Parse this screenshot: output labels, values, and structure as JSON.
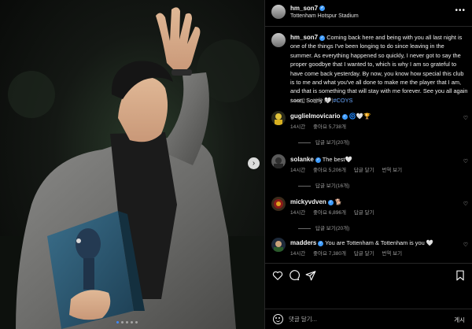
{
  "header": {
    "username": "hm_son7",
    "location": "Tottenham Hotspur Stadium",
    "more_icon": "more-horizontal-icon"
  },
  "caption": {
    "username": "hm_son7",
    "text": "Coming back here and being with you all last night is one of the things I've been longing to do since leaving in the summer. As everything happened so quickly, I never got to say the proper goodbye that I wanted to, which is why I am so grateful to have come back yesterday. By now, you know how special this club is to me and what you've all done to make me the player that I am, and that is something that will stay with me forever. See you all again soon, Sonny 🤍",
    "hashtag": "#COYS",
    "time": "14시간",
    "translate": "번역 보기"
  },
  "comments": [
    {
      "username": "guglielmovicario",
      "text": "🌀🤍🏆",
      "time": "14시간",
      "likes": "좋아요 5,738개",
      "reply": "",
      "translate": "",
      "replies": "답글 보기(20개)",
      "avatar_color": "#2a2a1a"
    },
    {
      "username": "solanke",
      "text": "The best🤍",
      "time": "14시간",
      "likes": "좋아요 5,206개",
      "reply": "답글 달기",
      "translate": "번역 보기",
      "replies": "답글 보기(16개)",
      "avatar_color": "#5a5a5a"
    },
    {
      "username": "mickyvdven",
      "text": "🐕",
      "time": "14시간",
      "likes": "좋아요 6,896개",
      "reply": "답글 달기",
      "translate": "",
      "replies": "답글 보기(20개)",
      "avatar_color": "#3a2a1a"
    },
    {
      "username": "madders",
      "text": "You are Tottenham & Tottenham is you 🤍",
      "time": "14시간",
      "likes": "좋아요 7,380개",
      "reply": "답글 달기",
      "translate": "번역 보기",
      "replies": "",
      "avatar_color": "#1e2a3a"
    }
  ],
  "actions": {
    "like_icon": "heart-icon",
    "comment_icon": "comment-icon",
    "share_icon": "send-icon",
    "save_icon": "bookmark-icon"
  },
  "comment_box": {
    "placeholder": "댓글 달기...",
    "post_label": "게시"
  },
  "colors": {
    "background": "#000000",
    "verified": "#3d9bff",
    "hashtag": "#6aa8ff",
    "muted_text": "#9a9a9a"
  }
}
